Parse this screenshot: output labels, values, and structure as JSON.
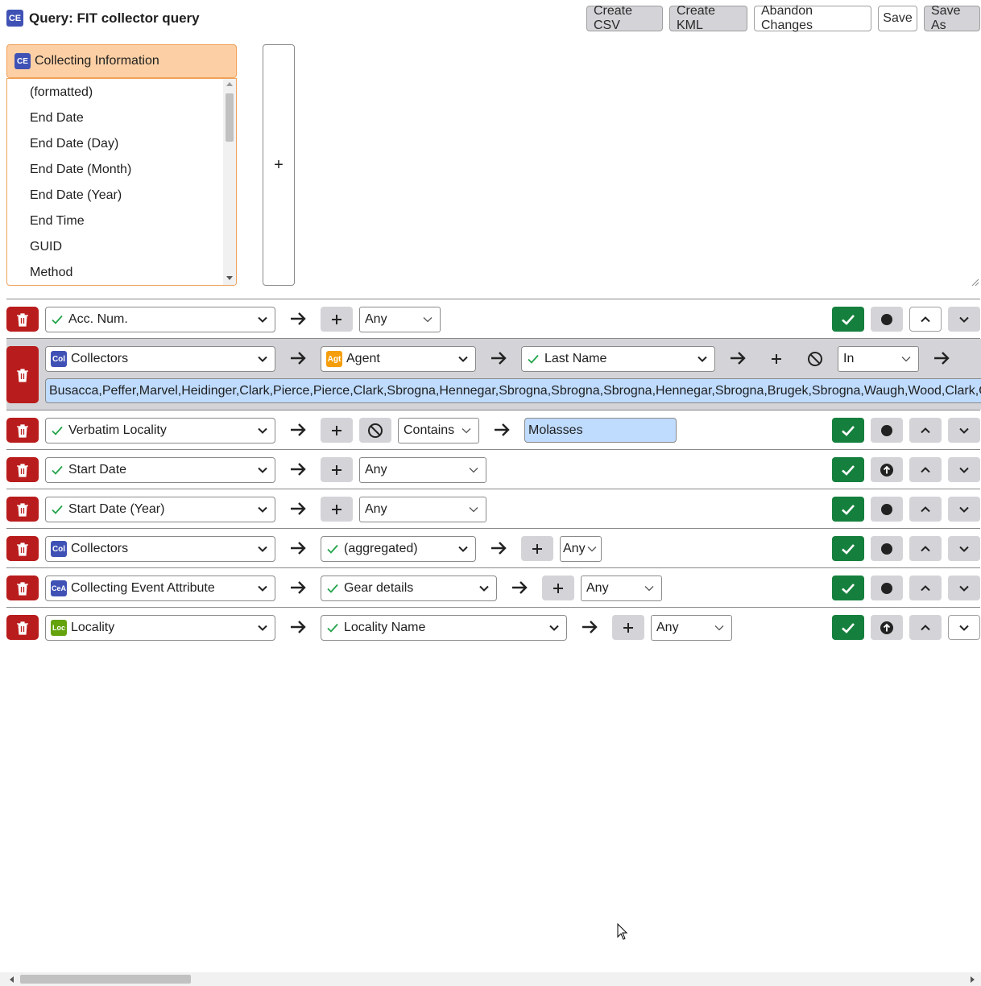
{
  "header": {
    "icon_text": "CE",
    "title": "Query: FIT collector query",
    "buttons": {
      "create_csv": "Create CSV",
      "create_kml": "Create KML",
      "abandon": "Abandon Changes",
      "save": "Save",
      "save_as": "Save As"
    }
  },
  "picker": {
    "table_icon": "CE",
    "table_label": "Collecting Information",
    "fields": [
      "(formatted)",
      "End Date",
      "End Date (Day)",
      "End Date (Month)",
      "End Date (Year)",
      "End Time",
      "GUID",
      "Method"
    ],
    "add_symbol": "+"
  },
  "icons": {
    "col": "Col",
    "agt": "Agt",
    "cea": "CeA",
    "loc": "Loc"
  },
  "lines": [
    {
      "field": "Acc. Num.",
      "operator": "Any"
    },
    {
      "table": "Collectors",
      "relation": "Agent",
      "field": "Last Name",
      "operator": "In",
      "value": "Busacca,Peffer,Marvel,Heidinger,Clark,Pierce,Pierce,Clark,Sbrogna,Hennegar,Sbrogna,Sbrogna,Sbrogna,Hennegar,Sbrogna,Brugek,Sbrogna,Waugh,Wood,Clark,Clark,Wood"
    },
    {
      "field": "Verbatim Locality",
      "operator": "Contains",
      "value": "Molasses"
    },
    {
      "field": "Start Date",
      "operator": "Any"
    },
    {
      "field": "Start Date (Year)",
      "operator": "Any"
    },
    {
      "table": "Collectors",
      "field": "(aggregated)",
      "operator": "Any"
    },
    {
      "table": "Collecting Event Attribute",
      "field": "Gear details",
      "operator": "Any"
    },
    {
      "table": "Locality",
      "field": "Locality Name",
      "operator": "Any"
    }
  ],
  "colors": {
    "accent_orange": "#fdcfa4",
    "delete_red": "#b91c1c",
    "display_green": "#15803d",
    "table_blue": "#3f51b5",
    "agent_orange": "#f59e0b",
    "locality_green": "#65a30d"
  }
}
